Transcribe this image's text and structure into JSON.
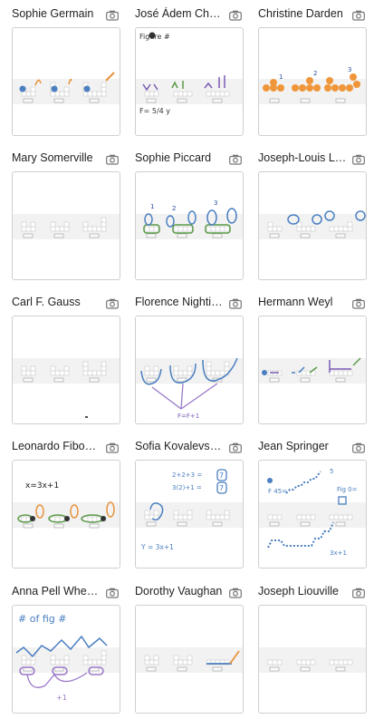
{
  "cards": [
    {
      "name": "Sophie Germain"
    },
    {
      "name": "José Ádem Chávez"
    },
    {
      "name": "Christine Darden"
    },
    {
      "name": "Mary Somerville"
    },
    {
      "name": "Sophie Piccard"
    },
    {
      "name": "Joseph-Louis Lagrange"
    },
    {
      "name": "Carl F. Gauss"
    },
    {
      "name": "Florence Nightingale"
    },
    {
      "name": "Hermann Weyl"
    },
    {
      "name": "Leonardo Fibonacci"
    },
    {
      "name": "Sofia Kovalevskaya"
    },
    {
      "name": "Jean Springer"
    },
    {
      "name": "Anna Pell Wheeler"
    },
    {
      "name": "Dorothy Vaughan"
    },
    {
      "name": "Joseph Liouville"
    }
  ],
  "annotations": {
    "jose_top": "Figure #",
    "jose_bottom": "F= 5/4 y",
    "darden_1": "1",
    "darden_2": "2",
    "darden_3": "3",
    "piccard_1": "1",
    "piccard_2": "2",
    "piccard_3": "3",
    "nightingale_formula": "F=F+1",
    "fibonacci_formula": "x=3x+1",
    "kovalevs_eq1": "2+2+3 =",
    "kovalevs_eq2": "3(2)+1 =",
    "kovalevs_val1": "7",
    "kovalevs_val2": "7",
    "kovalevs_bottom": "Y = 3x+1",
    "springer_f45": "F 45=",
    "springer_fig0": "Fig 0=",
    "springer_5": "5",
    "springer_3x1": "3x+1",
    "pell_top": "# of fig #",
    "pell_bottom": "+1"
  },
  "icons": {
    "card_action": "camera-icon"
  }
}
